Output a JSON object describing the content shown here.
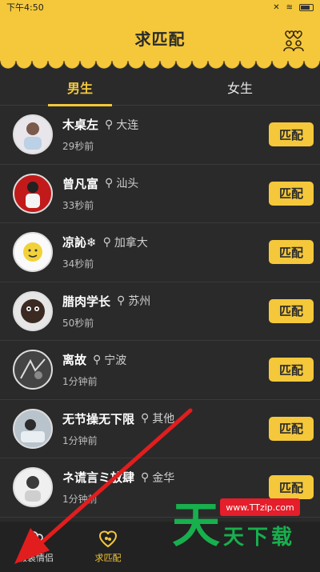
{
  "status_bar": {
    "time": "下午4:50"
  },
  "header": {
    "title": "求匹配",
    "couple_icon": "couple-hearts-icon"
  },
  "tabs": [
    {
      "label": "男生",
      "active": true
    },
    {
      "label": "女生",
      "active": false
    }
  ],
  "users": [
    {
      "name": "木桌左",
      "location": "大连",
      "time": "29秒前",
      "button": "匹配"
    },
    {
      "name": "曾凡富",
      "location": "汕头",
      "time": "33秒前",
      "button": "匹配"
    },
    {
      "name": "凉訫❄",
      "location": "加拿大",
      "time": "34秒前",
      "button": "匹配"
    },
    {
      "name": "腊肉学长",
      "location": "苏州",
      "time": "50秒前",
      "button": "匹配"
    },
    {
      "name": "离故",
      "location": "宁波",
      "time": "1分钟前",
      "button": "匹配"
    },
    {
      "name": "无节操无下限",
      "location": "其他",
      "time": "1分钟前",
      "button": "匹配"
    },
    {
      "name": "ネ谎言ミ放肆",
      "location": "金华",
      "time": "1分钟前",
      "button": "匹配"
    }
  ],
  "bottom_nav": [
    {
      "label": "假装情侣",
      "icon": "couple-icon",
      "active": false
    },
    {
      "label": "求匹配",
      "icon": "heart-match-icon",
      "active": true
    }
  ],
  "watermark": {
    "big": "天",
    "small": "天下载",
    "url": "www.TTzip.com"
  },
  "colors": {
    "accent": "#f4c83a",
    "background": "#2a2a2b",
    "arrow": "#e21d1d",
    "watermark_green": "#17b04d"
  }
}
